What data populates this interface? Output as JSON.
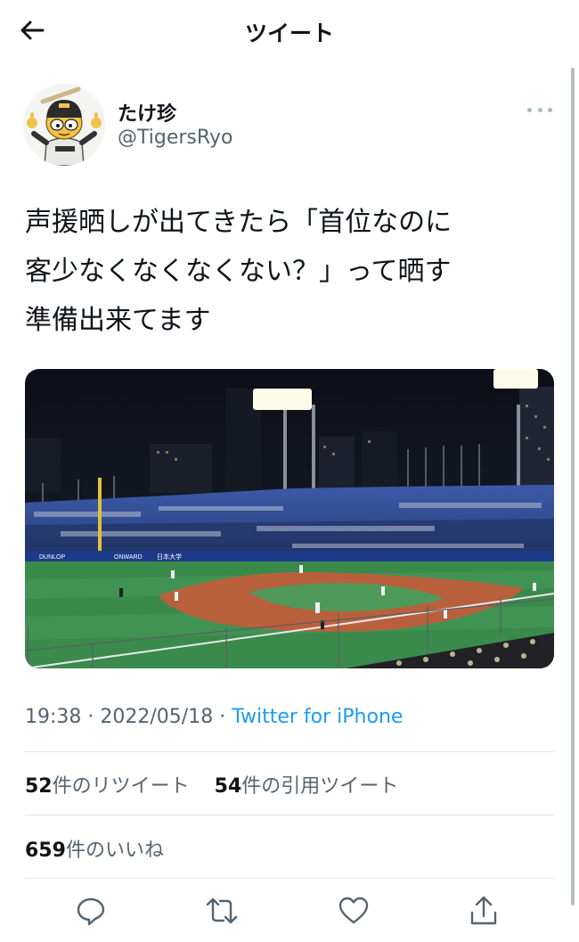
{
  "header": {
    "title": "ツイート",
    "back_icon": "arrow-left-icon"
  },
  "user": {
    "display_name": "たけ珍",
    "handle": "@TigersRyo",
    "avatar_icon": "avatar-icon",
    "more_icon": "more-dots-icon"
  },
  "tweet": {
    "text": "声援晒しが出てきたら「首位なのに\n客少なくなくなくない？」って晒す\n準備出来てます",
    "media_alt_icon": "baseball-stadium-photo"
  },
  "meta": {
    "time": "19:38",
    "sep1": " · ",
    "date": "2022/05/18",
    "sep2": " · ",
    "source": "Twitter for iPhone"
  },
  "stats": {
    "retweets_count": "52",
    "retweets_label": "件のリツイート",
    "quotes_count": "54",
    "quotes_label": "件の引用ツイート",
    "likes_count": "659",
    "likes_label": "件のいいね"
  },
  "actions": {
    "reply_icon": "reply-icon",
    "retweet_icon": "retweet-icon",
    "like_icon": "heart-icon",
    "share_icon": "share-icon"
  },
  "colors": {
    "accent": "#1d9bf0",
    "text_primary": "#0f1419",
    "text_secondary": "#536471",
    "divider": "#e1e6ea"
  }
}
